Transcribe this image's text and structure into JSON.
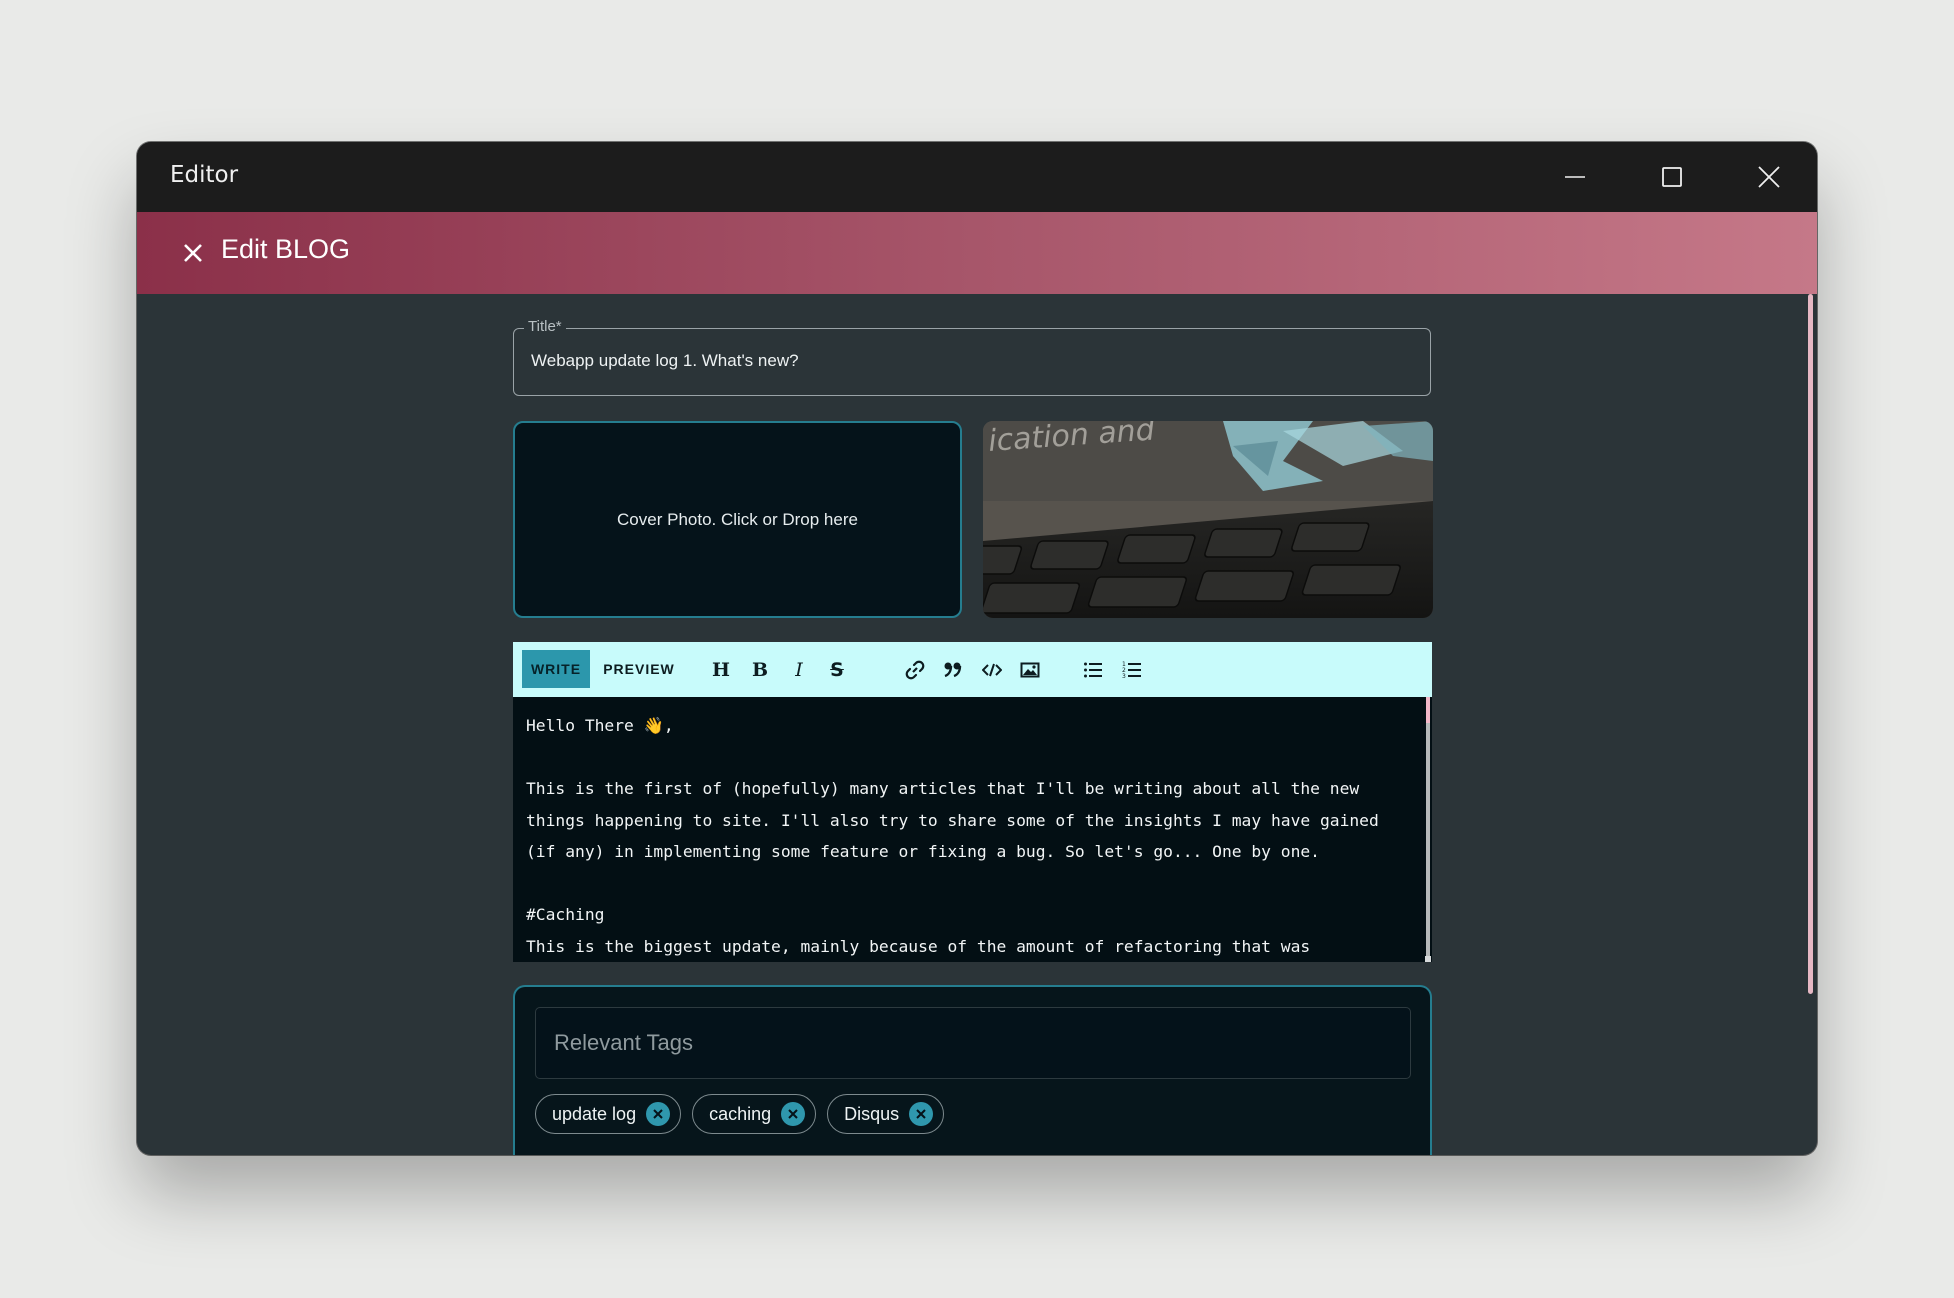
{
  "window": {
    "title": "Editor"
  },
  "appbar": {
    "heading": "Edit BLOG",
    "close_icon": "close-icon"
  },
  "form": {
    "title_label": "Title*",
    "title_value": "Webapp update log 1. What's new?",
    "cover_dropzone_text": "Cover Photo. Click or Drop here",
    "cover_image_text": "ication and"
  },
  "toolbar": {
    "write_label": "WRITE",
    "preview_label": "PREVIEW",
    "icons": [
      "heading-icon",
      "bold-icon",
      "italic-icon",
      "strikethrough-icon",
      "link-icon",
      "quote-icon",
      "code-icon",
      "image-icon",
      "bulleted-list-icon",
      "numbered-list-icon"
    ]
  },
  "editor": {
    "content": "Hello There 👋,\n\nThis is the first of (hopefully) many articles that I'll be writing about all the new things happening to site. I'll also try to share some of the insights I may have gained (if any) in implementing some feature or fixing a bug. So let's go... One by one.\n\n#Caching\nThis is the biggest update, mainly because of the amount of refactoring that was"
  },
  "tags": {
    "placeholder": "Relevant Tags",
    "items": [
      "update log",
      "caching",
      "Disqus"
    ]
  },
  "colors": {
    "appbar_start": "#8b3049",
    "appbar_end": "#c57888",
    "accent": "#2f97ad",
    "toolbar_bg": "#c8fbfb"
  }
}
